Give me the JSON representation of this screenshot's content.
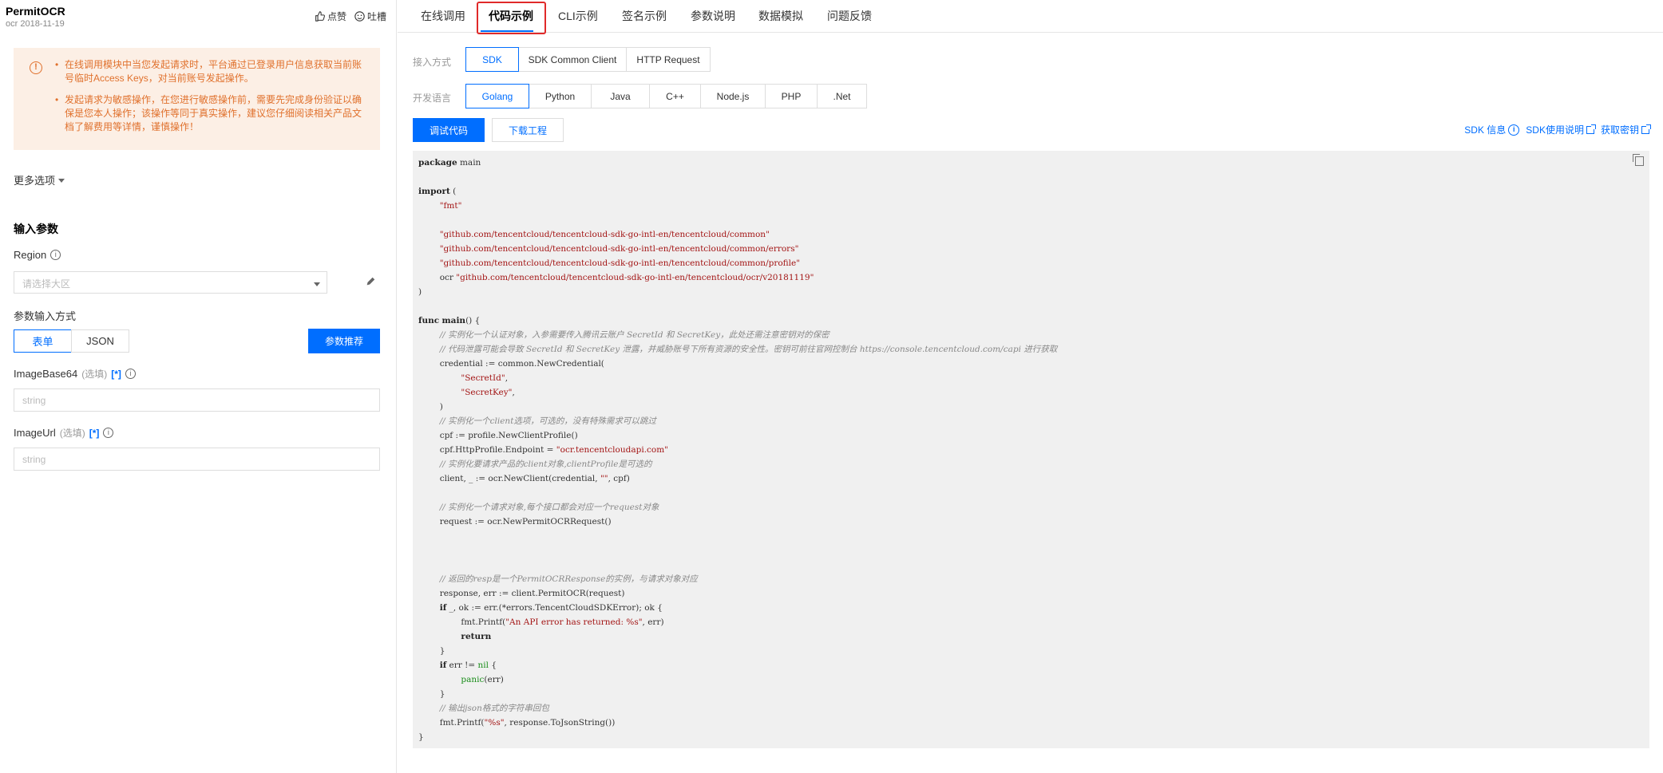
{
  "header": {
    "api_name": "PermitOCR",
    "api_version": "ocr 2018-11-19",
    "like_label": "点赞",
    "feedback_label": "吐槽"
  },
  "warning": {
    "items": [
      "在线调用模块中当您发起请求时，平台通过已登录用户信息获取当前账号临时Access Keys，对当前账号发起操作。",
      "发起请求为敏感操作，在您进行敏感操作前，需要先完成身份验证以确保是您本人操作；该操作等同于真实操作，建议您仔细阅读相关产品文档了解费用等详情，谨慎操作！"
    ]
  },
  "more_options": "更多选项",
  "input_params": {
    "title": "输入参数",
    "region_label": "Region",
    "region_placeholder": "请选择大区",
    "mode_label": "参数输入方式",
    "mode_form": "表单",
    "mode_json": "JSON",
    "recommend_button": "参数推荐",
    "fields": [
      {
        "name": "ImageBase64",
        "optional": "(选填)",
        "tag": "[*]",
        "placeholder": "string"
      },
      {
        "name": "ImageUrl",
        "optional": "(选填)",
        "tag": "[*]",
        "placeholder": "string"
      }
    ]
  },
  "top_tabs": [
    "在线调用",
    "代码示例",
    "CLI示例",
    "签名示例",
    "参数说明",
    "数据模拟",
    "问题反馈"
  ],
  "access_mode": {
    "label": "接入方式",
    "options": [
      "SDK",
      "SDK Common Client",
      "HTTP Request"
    ],
    "selected": "SDK"
  },
  "language": {
    "label": "开发语言",
    "options": [
      "Golang",
      "Python",
      "Java",
      "C++",
      "Node.js",
      "PHP",
      ".Net"
    ],
    "selected": "Golang"
  },
  "actions": {
    "debug": "调试代码",
    "download": "下载工程"
  },
  "links": {
    "sdk_info": "SDK 信息",
    "sdk_usage": "SDK使用说明",
    "get_key": "获取密钥"
  },
  "code": {
    "language": "go",
    "lines": [
      [
        [
          "kw",
          "package"
        ],
        [
          "t",
          " main"
        ]
      ],
      [],
      [
        [
          "kw",
          "import"
        ],
        [
          "t",
          " ("
        ]
      ],
      [
        [
          "t",
          "        "
        ],
        [
          "str",
          "\"fmt\""
        ]
      ],
      [],
      [
        [
          "t",
          "        "
        ],
        [
          "str",
          "\"github.com/tencentcloud/tencentcloud-sdk-go-intl-en/tencentcloud/common\""
        ]
      ],
      [
        [
          "t",
          "        "
        ],
        [
          "str",
          "\"github.com/tencentcloud/tencentcloud-sdk-go-intl-en/tencentcloud/common/errors\""
        ]
      ],
      [
        [
          "t",
          "        "
        ],
        [
          "str",
          "\"github.com/tencentcloud/tencentcloud-sdk-go-intl-en/tencentcloud/common/profile\""
        ]
      ],
      [
        [
          "t",
          "        ocr "
        ],
        [
          "str",
          "\"github.com/tencentcloud/tencentcloud-sdk-go-intl-en/tencentcloud/ocr/v20181119\""
        ]
      ],
      [
        [
          "t",
          ")"
        ]
      ],
      [],
      [
        [
          "kw",
          "func"
        ],
        [
          "t",
          " "
        ],
        [
          "kw",
          "main"
        ],
        [
          "t",
          "() {"
        ]
      ],
      [
        [
          "t",
          "        "
        ],
        [
          "cm",
          "// 实例化一个认证对象，入参需要传入腾讯云账户 SecretId 和 SecretKey，此处还需注意密钥对的保密"
        ]
      ],
      [
        [
          "t",
          "        "
        ],
        [
          "cm",
          "// 代码泄露可能会导致 SecretId 和 SecretKey 泄露，并威胁账号下所有资源的安全性。密钥可前往官网控制台 https://console.tencentcloud.com/capi 进行获取"
        ]
      ],
      [
        [
          "t",
          "        credential := common.NewCredential("
        ]
      ],
      [
        [
          "t",
          "                "
        ],
        [
          "str",
          "\"SecretId\""
        ],
        [
          "t",
          ","
        ]
      ],
      [
        [
          "t",
          "                "
        ],
        [
          "str",
          "\"SecretKey\""
        ],
        [
          "t",
          ","
        ]
      ],
      [
        [
          "t",
          "        )"
        ]
      ],
      [
        [
          "t",
          "        "
        ],
        [
          "cm",
          "// 实例化一个client选项，可选的，没有特殊需求可以跳过"
        ]
      ],
      [
        [
          "t",
          "        cpf := profile.NewClientProfile()"
        ]
      ],
      [
        [
          "t",
          "        cpf.HttpProfile.Endpoint = "
        ],
        [
          "str",
          "\"ocr.tencentcloudapi.com\""
        ]
      ],
      [
        [
          "t",
          "        "
        ],
        [
          "cm",
          "// 实例化要请求产品的client对象,clientProfile是可选的"
        ]
      ],
      [
        [
          "t",
          "        client, _ := ocr.NewClient(credential, "
        ],
        [
          "str",
          "\"\""
        ],
        [
          "t",
          ", cpf)"
        ]
      ],
      [],
      [
        [
          "t",
          "        "
        ],
        [
          "cm",
          "// 实例化一个请求对象,每个接口都会对应一个request对象"
        ]
      ],
      [
        [
          "t",
          "        request := ocr.NewPermitOCRRequest()"
        ]
      ],
      [],
      [],
      [],
      [
        [
          "t",
          "        "
        ],
        [
          "cm",
          "// 返回的resp是一个PermitOCRResponse的实例，与请求对象对应"
        ]
      ],
      [
        [
          "t",
          "        response, err := client.PermitOCR(request)"
        ]
      ],
      [
        [
          "t",
          "        "
        ],
        [
          "kw",
          "if"
        ],
        [
          "t",
          " _, ok := err.(*errors.TencentCloudSDKError); ok {"
        ]
      ],
      [
        [
          "t",
          "                fmt.Printf("
        ],
        [
          "str",
          "\"An API error has returned: %s\""
        ],
        [
          "t",
          ", err)"
        ]
      ],
      [
        [
          "t",
          "                "
        ],
        [
          "kw",
          "return"
        ]
      ],
      [
        [
          "t",
          "        }"
        ]
      ],
      [
        [
          "t",
          "        "
        ],
        [
          "kw",
          "if"
        ],
        [
          "t",
          " err != "
        ],
        [
          "lit",
          "nil"
        ],
        [
          "t",
          " {"
        ]
      ],
      [
        [
          "t",
          "                "
        ],
        [
          "lit",
          "panic"
        ],
        [
          "t",
          "(err)"
        ]
      ],
      [
        [
          "t",
          "        }"
        ]
      ],
      [
        [
          "t",
          "        "
        ],
        [
          "cm",
          "// 输出json格式的字符串回包"
        ]
      ],
      [
        [
          "t",
          "        fmt.Printf("
        ],
        [
          "str",
          "\"%s\""
        ],
        [
          "t",
          ", response.ToJsonString())"
        ]
      ],
      [
        [
          "t",
          "}"
        ]
      ]
    ]
  }
}
